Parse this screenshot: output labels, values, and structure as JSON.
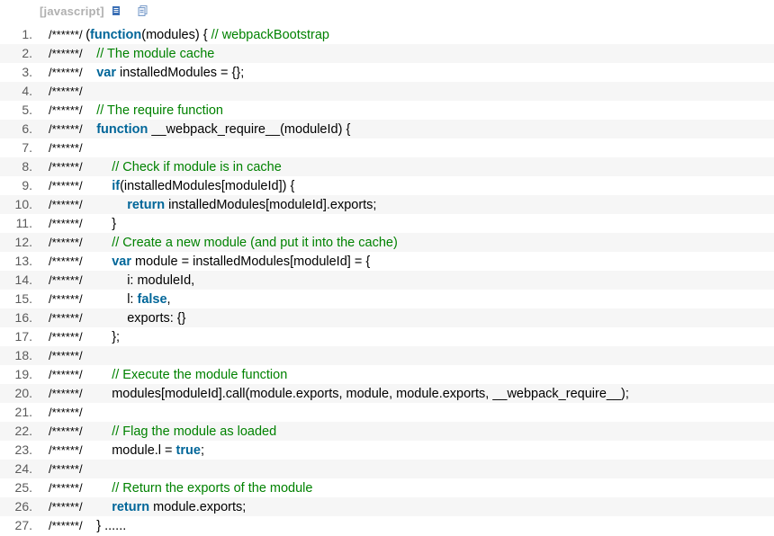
{
  "toolbar": {
    "language_label": "[javascript]",
    "icons": [
      "view-source-icon",
      "copy-icon"
    ]
  },
  "colors": {
    "gutter_bar": "#6ec15a",
    "comment": "#008200",
    "keyword": "#006699",
    "line_number": "#5b5b5b",
    "stripe": "#f6f6f6"
  },
  "lines": [
    {
      "n": "1.",
      "indent": 0,
      "tokens": [
        [
          "m",
          "/******/ "
        ],
        [
          "p",
          "("
        ],
        [
          "k",
          "function"
        ],
        [
          "p",
          "(modules) { "
        ],
        [
          "c",
          "// webpackBootstrap"
        ]
      ]
    },
    {
      "n": "2.",
      "indent": 1,
      "tokens": [
        [
          "m",
          "/******/ "
        ],
        [
          "c",
          "// The module cache"
        ]
      ]
    },
    {
      "n": "3.",
      "indent": 1,
      "tokens": [
        [
          "m",
          "/******/ "
        ],
        [
          "k",
          "var"
        ],
        [
          "p",
          " installedModules = {};"
        ]
      ]
    },
    {
      "n": "4.",
      "indent": 0,
      "tokens": [
        [
          "m",
          "/******/"
        ]
      ]
    },
    {
      "n": "5.",
      "indent": 1,
      "tokens": [
        [
          "m",
          "/******/ "
        ],
        [
          "c",
          "// The require function"
        ]
      ]
    },
    {
      "n": "6.",
      "indent": 1,
      "tokens": [
        [
          "m",
          "/******/ "
        ],
        [
          "k",
          "function"
        ],
        [
          "p",
          " __webpack_require__(moduleId) {"
        ]
      ]
    },
    {
      "n": "7.",
      "indent": 0,
      "tokens": [
        [
          "m",
          "/******/"
        ]
      ]
    },
    {
      "n": "8.",
      "indent": 2,
      "tokens": [
        [
          "m",
          "/******/ "
        ],
        [
          "c",
          "// Check if module is in cache"
        ]
      ]
    },
    {
      "n": "9.",
      "indent": 2,
      "tokens": [
        [
          "m",
          "/******/ "
        ],
        [
          "k",
          "if"
        ],
        [
          "p",
          "(installedModules[moduleId]) {"
        ]
      ]
    },
    {
      "n": "10.",
      "indent": 3,
      "tokens": [
        [
          "m",
          "/******/ "
        ],
        [
          "k",
          "return"
        ],
        [
          "p",
          " installedModules[moduleId].exports;"
        ]
      ]
    },
    {
      "n": "11.",
      "indent": 2,
      "tokens": [
        [
          "m",
          "/******/ "
        ],
        [
          "p",
          "}"
        ]
      ]
    },
    {
      "n": "12.",
      "indent": 2,
      "tokens": [
        [
          "m",
          "/******/ "
        ],
        [
          "c",
          "// Create a new module (and put it into the cache)"
        ]
      ]
    },
    {
      "n": "13.",
      "indent": 2,
      "tokens": [
        [
          "m",
          "/******/ "
        ],
        [
          "k",
          "var"
        ],
        [
          "p",
          " module = installedModules[moduleId] = {"
        ]
      ]
    },
    {
      "n": "14.",
      "indent": 3,
      "tokens": [
        [
          "m",
          "/******/ "
        ],
        [
          "p",
          "i: moduleId,"
        ]
      ]
    },
    {
      "n": "15.",
      "indent": 3,
      "tokens": [
        [
          "m",
          "/******/ "
        ],
        [
          "p",
          "l: "
        ],
        [
          "k",
          "false"
        ],
        [
          "p",
          ","
        ]
      ]
    },
    {
      "n": "16.",
      "indent": 3,
      "tokens": [
        [
          "m",
          "/******/ "
        ],
        [
          "p",
          "exports: {}"
        ]
      ]
    },
    {
      "n": "17.",
      "indent": 2,
      "tokens": [
        [
          "m",
          "/******/ "
        ],
        [
          "p",
          "};"
        ]
      ]
    },
    {
      "n": "18.",
      "indent": 0,
      "tokens": [
        [
          "m",
          "/******/"
        ]
      ]
    },
    {
      "n": "19.",
      "indent": 2,
      "tokens": [
        [
          "m",
          "/******/ "
        ],
        [
          "c",
          "// Execute the module function"
        ]
      ]
    },
    {
      "n": "20.",
      "indent": 2,
      "tokens": [
        [
          "m",
          "/******/ "
        ],
        [
          "p",
          "modules[moduleId].call(module.exports, module, module.exports, __webpack_require__);"
        ]
      ]
    },
    {
      "n": "21.",
      "indent": 0,
      "tokens": [
        [
          "m",
          "/******/"
        ]
      ]
    },
    {
      "n": "22.",
      "indent": 2,
      "tokens": [
        [
          "m",
          "/******/ "
        ],
        [
          "c",
          "// Flag the module as loaded"
        ]
      ]
    },
    {
      "n": "23.",
      "indent": 2,
      "tokens": [
        [
          "m",
          "/******/ "
        ],
        [
          "p",
          "module.l = "
        ],
        [
          "k",
          "true"
        ],
        [
          "p",
          ";"
        ]
      ]
    },
    {
      "n": "24.",
      "indent": 0,
      "tokens": [
        [
          "m",
          "/******/"
        ]
      ]
    },
    {
      "n": "25.",
      "indent": 2,
      "tokens": [
        [
          "m",
          "/******/ "
        ],
        [
          "c",
          "// Return the exports of the module"
        ]
      ]
    },
    {
      "n": "26.",
      "indent": 2,
      "tokens": [
        [
          "m",
          "/******/ "
        ],
        [
          "k",
          "return"
        ],
        [
          "p",
          " module.exports;"
        ]
      ]
    },
    {
      "n": "27.",
      "indent": 1,
      "tokens": [
        [
          "m",
          "/******/ "
        ],
        [
          "p",
          "} ......"
        ]
      ]
    }
  ]
}
